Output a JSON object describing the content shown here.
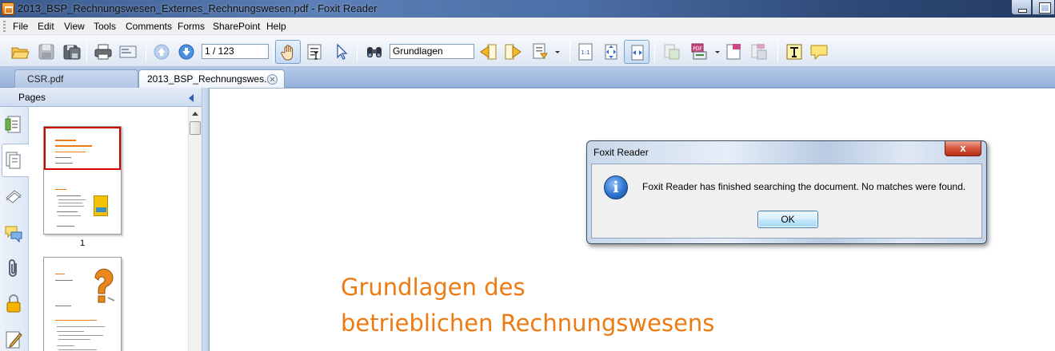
{
  "window": {
    "title": "2013_BSP_Rechnungswesen_Externes_Rechnungswesen.pdf - Foxit Reader"
  },
  "menu": {
    "items": [
      "File",
      "Edit",
      "View",
      "Tools",
      "Comments",
      "Forms",
      "SharePoint",
      "Help"
    ]
  },
  "toolbar": {
    "page_indicator": "1 / 123",
    "search_text": "Grundlagen"
  },
  "tabs": [
    {
      "label": "CSR.pdf",
      "active": false
    },
    {
      "label": "2013_BSP_Rechnungswes...",
      "active": true
    }
  ],
  "panel": {
    "title": "Pages",
    "thumbnails": [
      {
        "number": "1",
        "selected": true
      },
      {
        "number": "",
        "selected": false
      }
    ]
  },
  "document": {
    "heading_line1": "Grundlagen des",
    "heading_line2": "betrieblichen Rechnungswesens",
    "heading_color": "#ee7a12"
  },
  "dialog": {
    "title": "Foxit Reader",
    "close_label": "x",
    "message": "Foxit Reader has finished searching the document. No matches were found.",
    "ok_label": "OK",
    "icon": "info-icon"
  },
  "colors": {
    "accent": "#ee7a12",
    "selection": "#d40000",
    "tabbar": "#a7bee2"
  }
}
